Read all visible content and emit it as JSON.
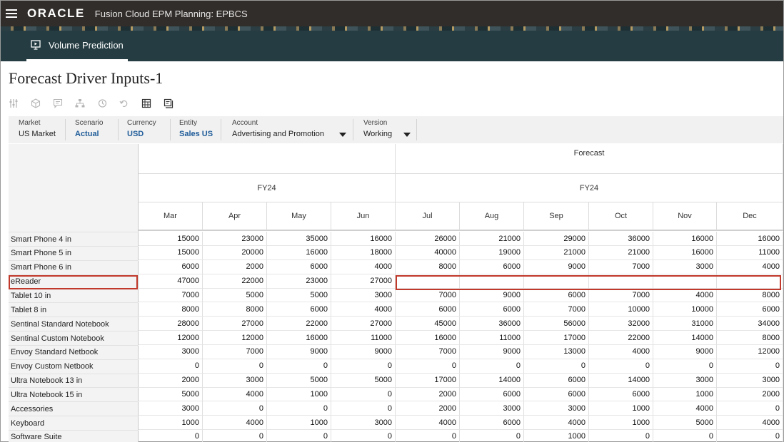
{
  "header": {
    "logo": "ORACLE",
    "app_title": "Fusion Cloud EPM Planning:  EPBCS"
  },
  "nav": {
    "tab_label": "Volume Prediction"
  },
  "page": {
    "title": "Forecast Driver Inputs-1"
  },
  "toolbar": {
    "icons": [
      "adjust-icon",
      "cube-icon",
      "comment-icon",
      "hierarchy-icon",
      "history-icon",
      "undo-icon",
      "grid-icon",
      "layout-icon"
    ]
  },
  "pov": [
    {
      "label": "Market",
      "value": "US Market",
      "link": false,
      "dropdown": false
    },
    {
      "label": "Scenario",
      "value": "Actual",
      "link": true,
      "dropdown": false
    },
    {
      "label": "Currency",
      "value": "USD",
      "link": true,
      "dropdown": false
    },
    {
      "label": "Entity",
      "value": "Sales US",
      "link": true,
      "dropdown": false
    },
    {
      "label": "Account",
      "value": "Advertising and Promotion",
      "link": false,
      "dropdown": true
    },
    {
      "label": "Version",
      "value": "Working",
      "link": false,
      "dropdown": true
    }
  ],
  "grid": {
    "forecast_label": "Forecast",
    "year_actual": "FY24",
    "year_forecast": "FY24",
    "months": [
      "Mar",
      "Apr",
      "May",
      "Jun",
      "Jul",
      "Aug",
      "Sep",
      "Oct",
      "Nov",
      "Dec"
    ],
    "rows": [
      {
        "label": "Smart Phone 4 in",
        "values": [
          "15000",
          "23000",
          "35000",
          "16000",
          "26000",
          "21000",
          "29000",
          "36000",
          "16000",
          "16000"
        ]
      },
      {
        "label": "Smart Phone 5 in",
        "values": [
          "15000",
          "20000",
          "16000",
          "18000",
          "40000",
          "19000",
          "21000",
          "21000",
          "16000",
          "11000"
        ]
      },
      {
        "label": "Smart Phone 6 in",
        "values": [
          "6000",
          "2000",
          "6000",
          "4000",
          "8000",
          "6000",
          "9000",
          "7000",
          "3000",
          "4000"
        ]
      },
      {
        "label": "eReader",
        "values": [
          "47000",
          "22000",
          "23000",
          "27000",
          "",
          "",
          "",
          "",
          "",
          ""
        ]
      },
      {
        "label": "Tablet 10 in",
        "values": [
          "7000",
          "5000",
          "5000",
          "3000",
          "7000",
          "9000",
          "6000",
          "7000",
          "4000",
          "8000"
        ]
      },
      {
        "label": "Tablet 8 in",
        "values": [
          "8000",
          "8000",
          "6000",
          "4000",
          "6000",
          "6000",
          "7000",
          "10000",
          "10000",
          "6000"
        ]
      },
      {
        "label": "Sentinal Standard Notebook",
        "values": [
          "28000",
          "27000",
          "22000",
          "27000",
          "45000",
          "36000",
          "56000",
          "32000",
          "31000",
          "34000"
        ]
      },
      {
        "label": "Sentinal Custom Notebook",
        "values": [
          "12000",
          "12000",
          "16000",
          "11000",
          "16000",
          "11000",
          "17000",
          "22000",
          "14000",
          "8000"
        ]
      },
      {
        "label": "Envoy Standard Netbook",
        "values": [
          "3000",
          "7000",
          "9000",
          "9000",
          "7000",
          "9000",
          "13000",
          "4000",
          "9000",
          "12000"
        ]
      },
      {
        "label": "Envoy Custom Netbook",
        "values": [
          "0",
          "0",
          "0",
          "0",
          "0",
          "0",
          "0",
          "0",
          "0",
          "0"
        ]
      },
      {
        "label": "Ultra Notebook 13 in",
        "values": [
          "2000",
          "3000",
          "5000",
          "5000",
          "17000",
          "14000",
          "6000",
          "14000",
          "3000",
          "3000"
        ]
      },
      {
        "label": "Ultra Notebook 15 in",
        "values": [
          "5000",
          "4000",
          "1000",
          "0",
          "2000",
          "6000",
          "6000",
          "6000",
          "1000",
          "2000"
        ]
      },
      {
        "label": "Accessories",
        "values": [
          "3000",
          "0",
          "0",
          "0",
          "2000",
          "3000",
          "3000",
          "1000",
          "4000",
          "0"
        ]
      },
      {
        "label": "Keyboard",
        "values": [
          "1000",
          "4000",
          "1000",
          "3000",
          "4000",
          "6000",
          "4000",
          "1000",
          "5000",
          "4000"
        ]
      },
      {
        "label": "Software Suite",
        "values": [
          "0",
          "0",
          "0",
          "0",
          "0",
          "0",
          "1000",
          "0",
          "0",
          "0"
        ]
      }
    ]
  }
}
